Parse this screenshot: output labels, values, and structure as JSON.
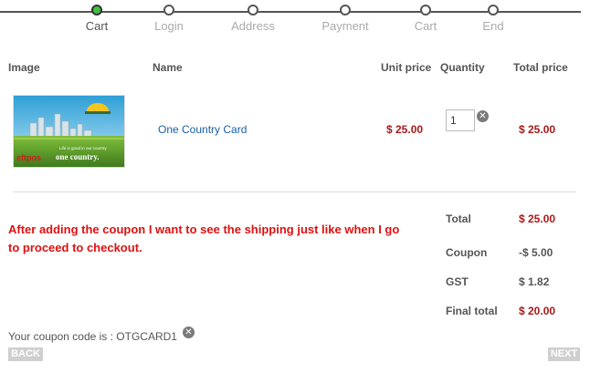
{
  "steps": [
    {
      "label": "Cart",
      "active": true
    },
    {
      "label": "Login",
      "active": false
    },
    {
      "label": "Address",
      "active": false
    },
    {
      "label": "Payment",
      "active": false
    },
    {
      "label": "Cart",
      "active": false
    },
    {
      "label": "End",
      "active": false
    }
  ],
  "table": {
    "headers": {
      "image": "Image",
      "name": "Name",
      "unit_price": "Unit price",
      "quantity": "Quantity",
      "total_price": "Total price"
    },
    "item": {
      "image_lines": [
        "eftpos",
        "one country.",
        "Life is good in our country."
      ],
      "name": "One Country Card",
      "unit_price": "$ 25.00",
      "quantity": "1",
      "total_price": "$ 25.00"
    }
  },
  "note": "After adding the coupon I want to see the shipping just like when I go to proceed to checkout.",
  "summary": {
    "total_label": "Total",
    "total_value": "$ 25.00",
    "coupon_label": "Coupon",
    "coupon_value": "-$ 5.00",
    "gst_label": "GST",
    "gst_value": "$ 1.82",
    "final_label": "Final total",
    "final_value": "$ 20.00"
  },
  "coupon": {
    "text": "Your coupon code is : OTGCARD1"
  },
  "nav": {
    "back": "BACK",
    "next": "NEXT"
  },
  "colors": {
    "price_red": "#a81919",
    "note_red": "#dd1111",
    "link_blue": "#1a5fa6",
    "active_step_green": "#3fbf3f"
  }
}
